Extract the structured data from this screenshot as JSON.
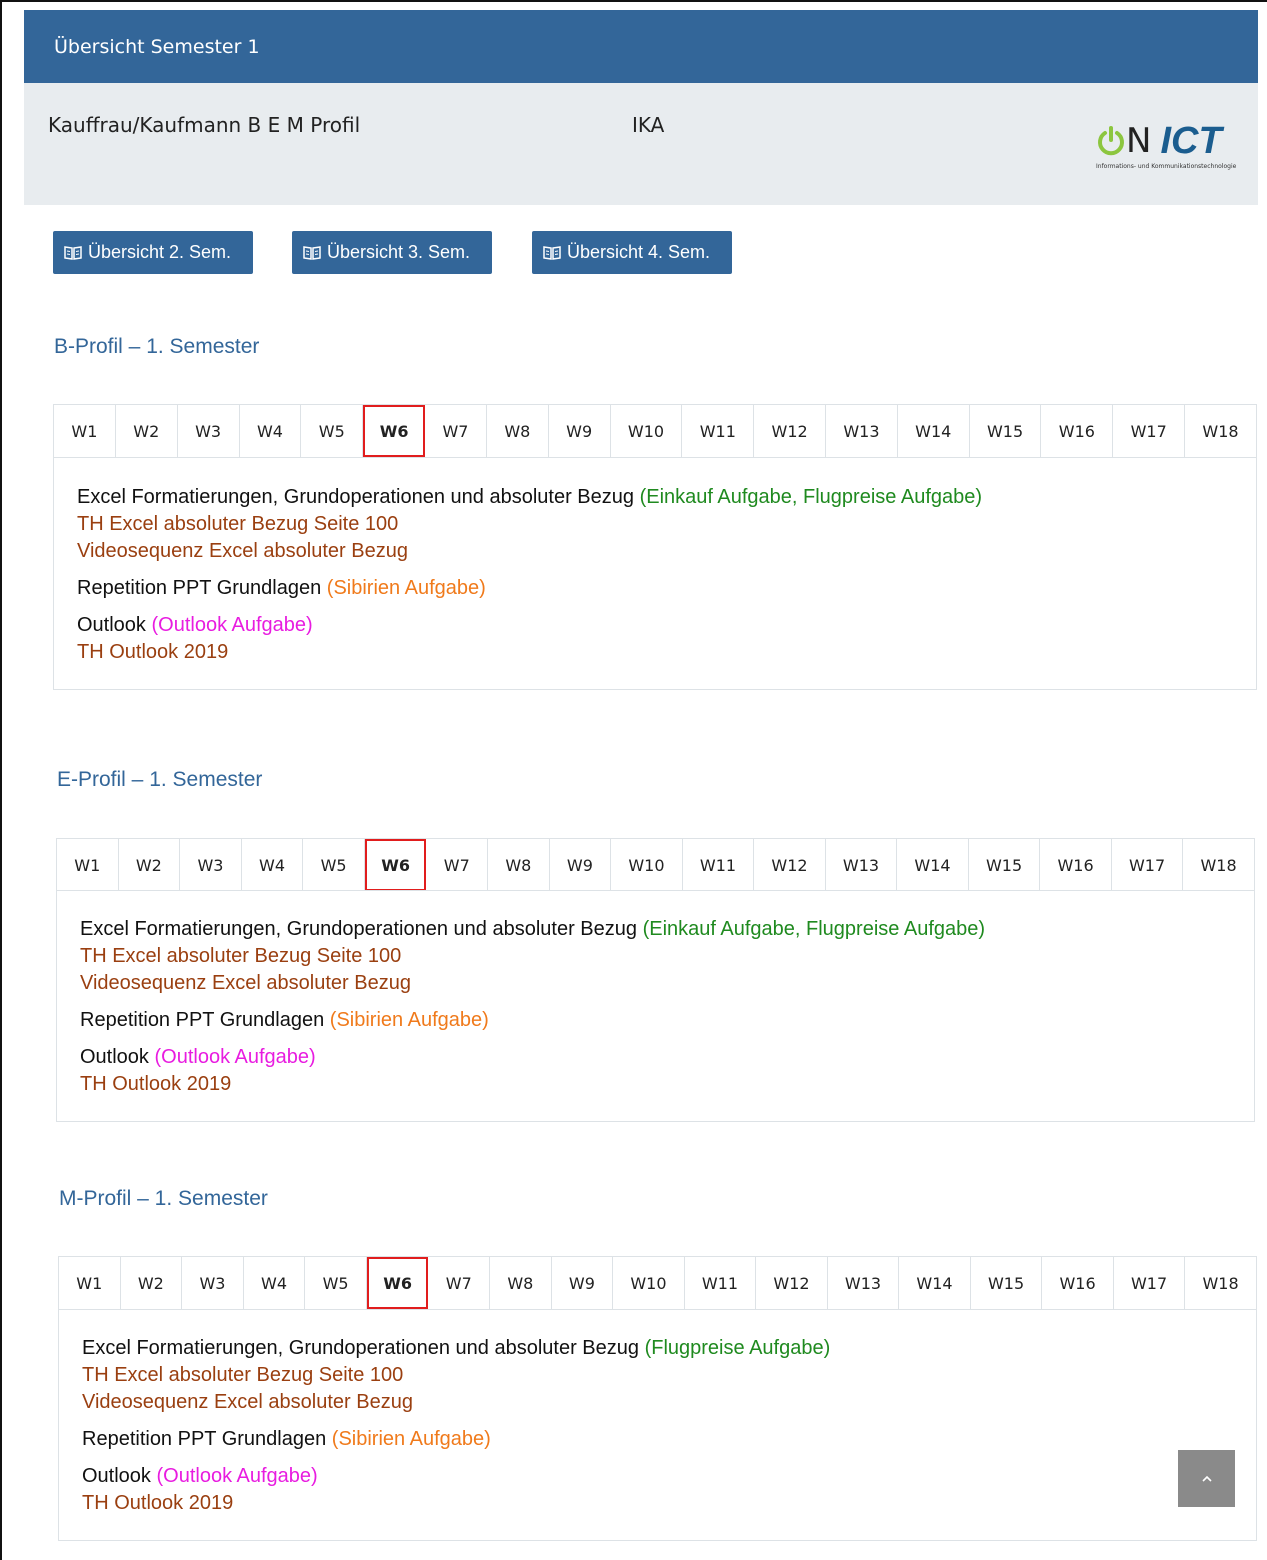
{
  "header": {
    "title": "Übersicht Semester 1",
    "program": "Kauffrau/Kaufmann B E M Profil",
    "subject": "IKA"
  },
  "logo": {
    "brand_n": "N",
    "brand_ict": "ICT",
    "tagline": "Informations- und Kommunikationstechnologie"
  },
  "nav": [
    {
      "label": "Übersicht 2. Sem."
    },
    {
      "label": "Übersicht 3. Sem."
    },
    {
      "label": "Übersicht 4. Sem."
    }
  ],
  "weeks": [
    "W1",
    "W2",
    "W3",
    "W4",
    "W5",
    "W6",
    "W7",
    "W8",
    "W9",
    "W10",
    "W11",
    "W12",
    "W13",
    "W14",
    "W15",
    "W16",
    "W17",
    "W18"
  ],
  "active_week": "W6",
  "colors": {
    "primary": "#336699",
    "highlight": "#e11d1d",
    "task_green": "#1f8a1f",
    "link_brown": "#9a3f10",
    "task_orange": "#f07a1b",
    "task_magenta": "#e81ce0"
  },
  "sections": [
    {
      "title": "B-Profil – 1. Semester",
      "excel_topic": "Excel Formatierungen, Grundoperationen und absoluter Bezug",
      "excel_tasks": "(Einkauf Aufgabe, Flugpreise Aufgabe)",
      "excel_th": "TH Excel absoluter Bezug Seite 100",
      "excel_video": "Videosequenz Excel absoluter Bezug",
      "ppt_topic": "Repetition PPT Grundlagen",
      "ppt_task": "(Sibirien Aufgabe)",
      "outlook_topic": "Outlook",
      "outlook_task": "(Outlook Aufgabe)",
      "outlook_th": "TH Outlook 2019"
    },
    {
      "title": "E-Profil – 1. Semester",
      "excel_topic": "Excel Formatierungen, Grundoperationen und absoluter Bezug",
      "excel_tasks": "(Einkauf Aufgabe, Flugpreise Aufgabe)",
      "excel_th": "TH Excel absoluter Bezug Seite 100",
      "excel_video": "Videosequenz Excel absoluter Bezug",
      "ppt_topic": "Repetition PPT Grundlagen",
      "ppt_task": "(Sibirien Aufgabe)",
      "outlook_topic": "Outlook",
      "outlook_task": "(Outlook Aufgabe)",
      "outlook_th": "TH Outlook 2019"
    },
    {
      "title": "M-Profil – 1. Semester",
      "excel_topic": "Excel Formatierungen, Grundoperationen und absoluter Bezug",
      "excel_tasks": "(Flugpreise Aufgabe)",
      "excel_th": "TH Excel absoluter Bezug Seite 100",
      "excel_video": "Videosequenz Excel absoluter Bezug",
      "ppt_topic": "Repetition PPT Grundlagen",
      "ppt_task": "(Sibirien Aufgabe)",
      "outlook_topic": "Outlook",
      "outlook_task": "(Outlook Aufgabe)",
      "outlook_th": "TH Outlook 2019"
    }
  ],
  "scroll_top_icon": "chevron-up-icon"
}
